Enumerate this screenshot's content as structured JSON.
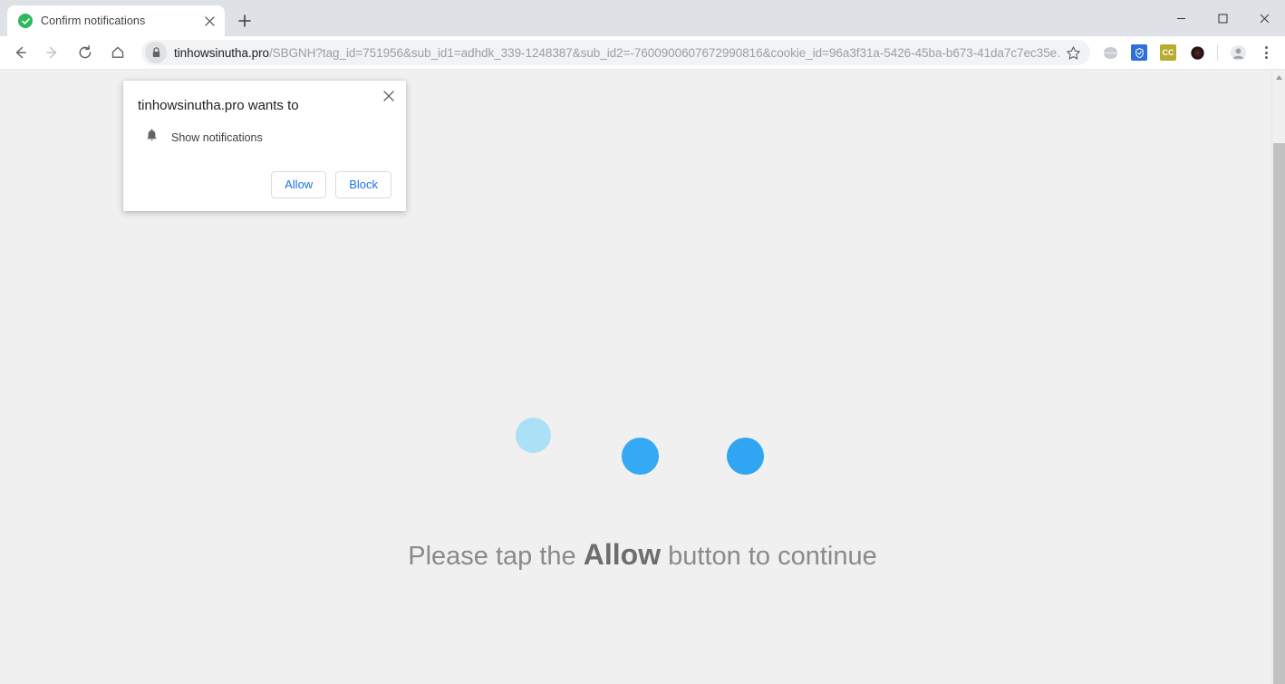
{
  "window": {
    "minimize_label": "Minimize",
    "maximize_label": "Maximize",
    "close_label": "Close"
  },
  "tabstrip": {
    "tabs": [
      {
        "title": "Confirm notifications",
        "favicon": "green-check-icon",
        "close_label": "Close tab"
      }
    ],
    "new_tab_label": "New tab"
  },
  "toolbar": {
    "back_label": "Back",
    "forward_label": "Forward",
    "reload_label": "Reload",
    "home_label": "Home",
    "bookmark_label": "Bookmark this tab",
    "url_display": "tinhowsinutha.pro/SBGNH?tag_id=751956&sub_id1=adhdk_339-1248387&sub_id2=-7600900607672990816&cookie_id=96a3f31a-5426-45ba-b673-41da7c7ec35e…",
    "url_host": "tinhowsinutha.pro",
    "url_path": "/SBGNH?tag_id=751956&sub_id1=adhdk_339-1248387&sub_id2=-7600900607672990816&cookie_id=96a3f31a-5426-45ba-b673-41da7c7ec35e…",
    "lock_icon": "lock-icon",
    "extensions": [
      {
        "name": "globe-extension-icon",
        "label": "",
        "bg": "#c8ccd0",
        "fg": "#ffffff"
      },
      {
        "name": "blue-extension-icon",
        "label": "",
        "bg": "#2d6fdb",
        "fg": "#ffffff"
      },
      {
        "name": "cc-extension-icon",
        "label": "CC",
        "bg": "#b6ac2e",
        "fg": "#ffffff"
      },
      {
        "name": "dark-circle-extension-icon",
        "label": "",
        "bg": "#2b1a1a",
        "fg": "#ffffff"
      }
    ],
    "profile_label": "Profile",
    "menu_label": "Customize and control Google Chrome"
  },
  "permission_dialog": {
    "title": "tinhowsinutha.pro wants to",
    "permission_icon": "bell-icon",
    "permission_label": "Show notifications",
    "allow_label": "Allow",
    "block_label": "Block",
    "close_label": "Close",
    "accent_color": "#1a73e8"
  },
  "page": {
    "message_prefix": "Please tap the ",
    "message_emphasis": "Allow",
    "message_suffix": " button to continue",
    "background_color": "#f0f0f0",
    "loader": {
      "dot_colors": [
        "#ace0f7",
        "#36a9f5",
        "#30a6f2"
      ]
    }
  },
  "scrollbar": {
    "up_arrow_label": "Scroll up",
    "thumb_label": "Vertical scrollbar thumb"
  }
}
